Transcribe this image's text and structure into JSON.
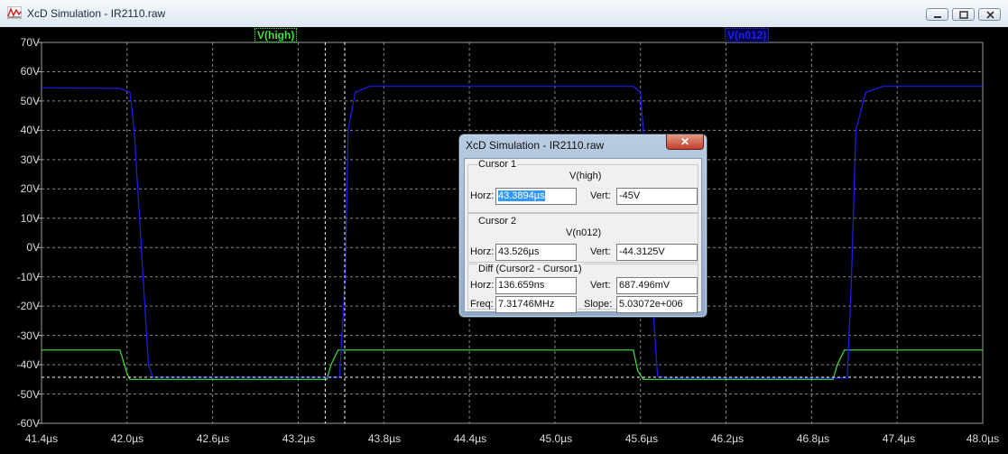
{
  "window": {
    "title": "XcD Simulation - IR2110.raw"
  },
  "plot": {
    "trace_labels": [
      {
        "name": "V(high)",
        "color": "#3fe13f"
      },
      {
        "name": "V(n012)",
        "color": "#1e1ef0"
      }
    ],
    "y_ticks": [
      "70V",
      "60V",
      "50V",
      "40V",
      "30V",
      "20V",
      "10V",
      "0V",
      "-10V",
      "-20V",
      "-30V",
      "-40V",
      "-50V",
      "-60V"
    ],
    "x_ticks": [
      "41.4µs",
      "42.0µs",
      "42.6µs",
      "43.2µs",
      "43.8µs",
      "44.4µs",
      "45.0µs",
      "45.6µs",
      "46.2µs",
      "46.8µs",
      "47.4µs",
      "48.0µs"
    ]
  },
  "chart_data": {
    "type": "line",
    "xlim": [
      41.4,
      48.0
    ],
    "ylim": [
      -60,
      70
    ],
    "grid": true,
    "series": [
      {
        "name": "V(high)",
        "color": "#3fe13f",
        "x": [
          41.4,
          41.95,
          42.0,
          42.02,
          43.4,
          43.43,
          43.48,
          44.5,
          45.55,
          45.58,
          45.62,
          46.95,
          46.98,
          47.03,
          48.0
        ],
        "y": [
          -35,
          -35,
          -43,
          -45,
          -45,
          -40,
          -35,
          -35,
          -35,
          -42,
          -45,
          -45,
          -40,
          -35,
          -35
        ]
      },
      {
        "name": "V(n012)",
        "color": "#1e1ef0",
        "x": [
          41.4,
          41.95,
          42.02,
          42.05,
          42.1,
          42.15,
          42.18,
          43.49,
          43.53,
          43.55,
          43.6,
          43.7,
          45.55,
          45.6,
          45.62,
          45.66,
          45.72,
          45.78,
          46.18,
          47.05,
          47.08,
          47.11,
          47.18,
          47.3,
          48.0
        ],
        "y": [
          54.5,
          54.3,
          53,
          40,
          0,
          -40,
          -44.3,
          -44.3,
          -10,
          40,
          53,
          55,
          55,
          53,
          40,
          0,
          -44,
          -44.5,
          -44.5,
          -44.5,
          -10,
          40,
          53,
          55,
          55
        ]
      }
    ],
    "cursors_x": [
      43.3894,
      43.526
    ],
    "cursor_level_y": -44.3
  },
  "dialog": {
    "title": "XcD Simulation - IR2110.raw",
    "cursor1": {
      "label": "Cursor 1",
      "signal": "V(high)",
      "horz_label": "Horz:",
      "horz_value": "43.3894µs",
      "vert_label": "Vert:",
      "vert_value": "-45V"
    },
    "cursor2": {
      "label": "Cursor 2",
      "signal": "V(n012)",
      "horz_label": "Horz:",
      "horz_value": "43.526µs",
      "vert_label": "Vert:",
      "vert_value": "-44.3125V"
    },
    "diff": {
      "label": "Diff (Cursor2 - Cursor1)",
      "horz_label": "Horz:",
      "horz_value": "136.659ns",
      "vert_label": "Vert:",
      "vert_value": "687.496mV",
      "freq_label": "Freq:",
      "freq_value": "7.31746MHz",
      "slope_label": "Slope:",
      "slope_value": "5.03072e+006"
    }
  }
}
